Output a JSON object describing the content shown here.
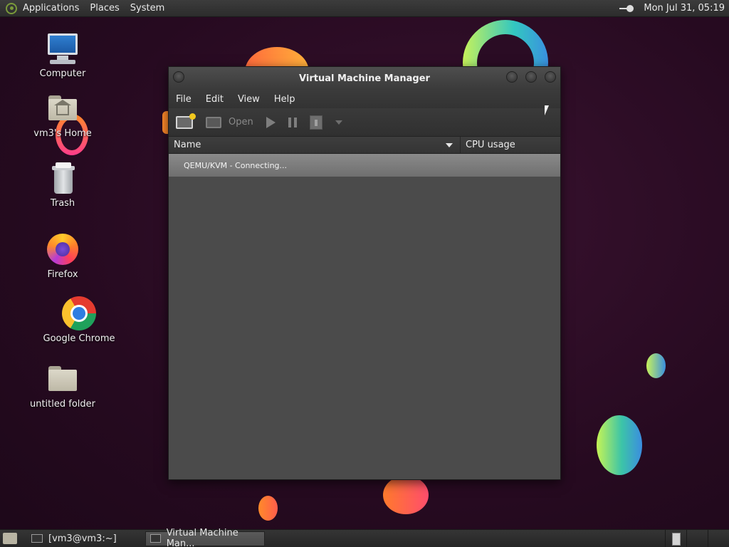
{
  "top_panel": {
    "menus": [
      "Applications",
      "Places",
      "System"
    ],
    "clock": "Mon Jul 31, 05:19"
  },
  "desktop": {
    "icons": [
      {
        "label": "Computer",
        "icon": "computer-icon"
      },
      {
        "label": "vm3's Home",
        "icon": "home-folder-icon"
      },
      {
        "label": "Trash",
        "icon": "trash-icon"
      },
      {
        "label": "Firefox",
        "icon": "firefox-icon"
      },
      {
        "label": "Google Chrome",
        "icon": "chrome-icon"
      },
      {
        "label": "untitled folder",
        "icon": "folder-icon"
      }
    ]
  },
  "window": {
    "title": "Virtual Machine Manager",
    "menus": [
      "File",
      "Edit",
      "View",
      "Help"
    ],
    "toolbar": {
      "open_label": "Open"
    },
    "columns": [
      "Name",
      "CPU usage"
    ],
    "rows": [
      {
        "name": "QEMU/KVM - Connecting..."
      }
    ]
  },
  "taskbar": {
    "tasks": [
      {
        "label": "[vm3@vm3:~]"
      },
      {
        "label": "Virtual Machine Man..."
      }
    ]
  },
  "colors": {
    "wallpaper": "#2a0c24",
    "panel": "#2c2c2c",
    "window_bg": "#4a4a4a",
    "selected_row": "#7c7c7c"
  }
}
